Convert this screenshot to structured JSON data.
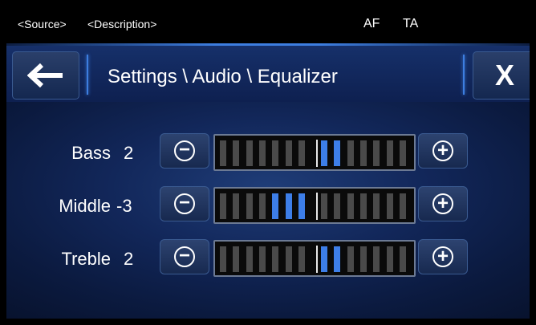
{
  "status": {
    "source": "<Source>",
    "description": "<Description>",
    "af": "AF",
    "ta": "TA"
  },
  "header": {
    "back_icon": "arrow-left-icon",
    "title": "Settings \\ Audio \\ Equalizer",
    "close_label": "X"
  },
  "equalizer": {
    "minus_symbol": "−",
    "plus_symbol": "+",
    "segments_per_side": 7,
    "rows": [
      {
        "label": "Bass",
        "value": "2",
        "level": 2
      },
      {
        "label": "Middle",
        "value": "-3",
        "level": -3
      },
      {
        "label": "Treble",
        "value": "2",
        "level": 2
      }
    ]
  },
  "colors": {
    "accent": "#3d7ee8",
    "background": "#12275a",
    "segment_inactive": "#4a4a4a"
  }
}
